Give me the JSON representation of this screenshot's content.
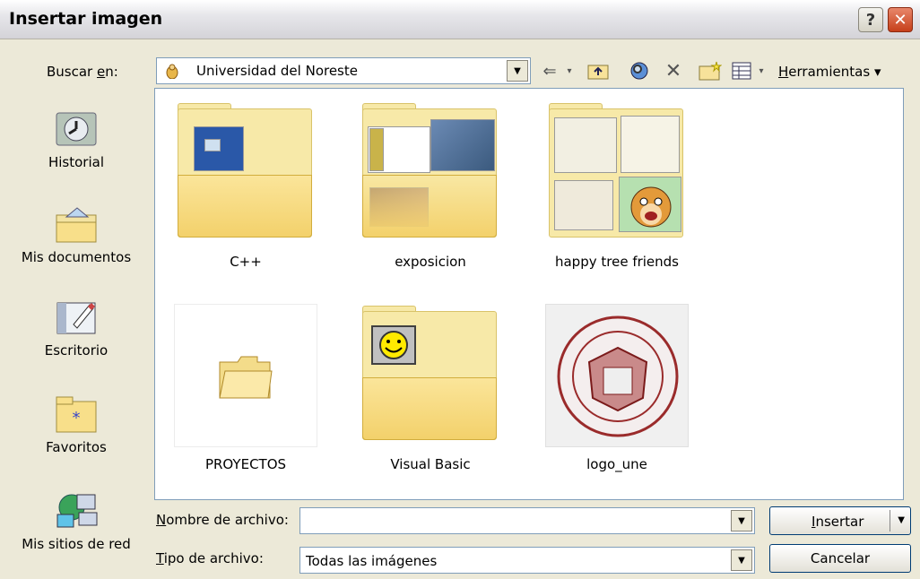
{
  "window": {
    "title": "Insertar imagen"
  },
  "toolbar": {
    "lookin_label_pre": "Buscar ",
    "lookin_label_u": "e",
    "lookin_label_post": "n:",
    "lookin_value": "Universidad del Noreste",
    "tools_label_u": "H",
    "tools_label_rest": "erramientas"
  },
  "places": [
    {
      "label": "Historial",
      "icon": "history-icon"
    },
    {
      "label": "Mis documentos",
      "icon": "my-documents-icon"
    },
    {
      "label": "Escritorio",
      "icon": "desktop-icon"
    },
    {
      "label": "Favoritos",
      "icon": "favorites-icon"
    },
    {
      "label": "Mis sitios de red",
      "icon": "network-places-icon"
    }
  ],
  "files": [
    {
      "name": "C++",
      "type": "folder"
    },
    {
      "name": "exposicion",
      "type": "folder"
    },
    {
      "name": "happy tree friends",
      "type": "folder"
    },
    {
      "name": "PROYECTOS",
      "type": "folder"
    },
    {
      "name": "Visual Basic",
      "type": "folder"
    },
    {
      "name": "logo_une",
      "type": "image"
    }
  ],
  "bottom": {
    "filename_label_u": "N",
    "filename_label_rest": "ombre de archivo:",
    "filename_value": "",
    "filetype_label_u": "T",
    "filetype_label_rest": "ipo de archivo:",
    "filetype_value": "Todas las imágenes",
    "insert_label_u": "I",
    "insert_label_rest": "nsertar",
    "cancel_label": "Cancelar"
  },
  "colors": {
    "window_bg": "#ece9d8",
    "field_border": "#7f9db9",
    "close_red": "#c63f1a"
  }
}
